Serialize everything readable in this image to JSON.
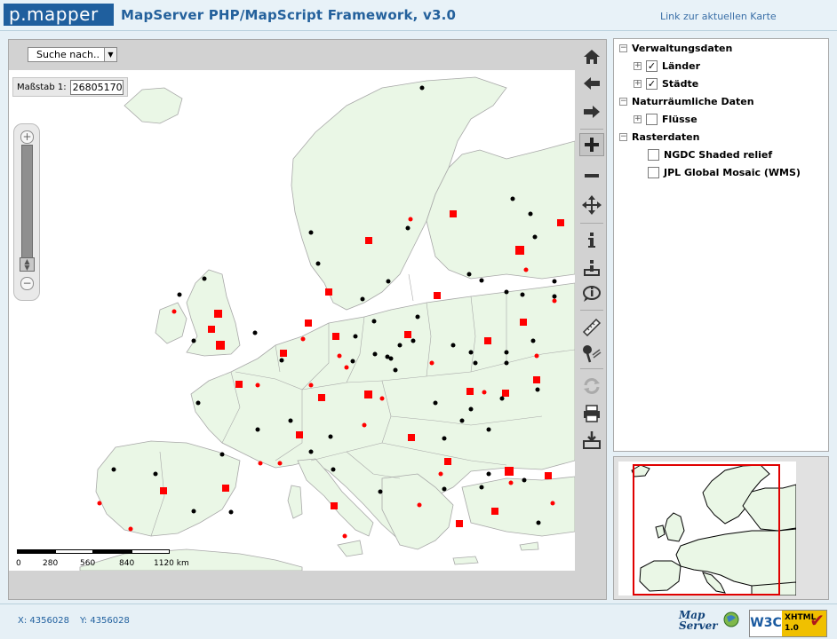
{
  "header": {
    "logo_text": "p.mapper",
    "title": "MapServer  PHP/MapScript  Framework, v3.0",
    "link_text": "Link zur aktuellen Karte"
  },
  "search": {
    "selected": "Suche nach.."
  },
  "scale": {
    "label": "Maßstab 1:",
    "value": "26805170"
  },
  "scalebar": {
    "ticks": [
      "0",
      "280",
      "560",
      "840",
      "1120 km"
    ]
  },
  "toc": {
    "groups": [
      {
        "label": "Verwaltungsdaten",
        "expanded": true,
        "layers": [
          {
            "label": "Länder",
            "checked": true,
            "expandable": true
          },
          {
            "label": "Städte",
            "checked": true,
            "expandable": true
          }
        ]
      },
      {
        "label": "Naturräumliche Daten",
        "expanded": true,
        "layers": [
          {
            "label": "Flüsse",
            "checked": false,
            "expandable": true
          }
        ]
      },
      {
        "label": "Rasterdaten",
        "expanded": true,
        "layers": [
          {
            "label": "NGDC Shaded relief",
            "checked": false,
            "expandable": false
          },
          {
            "label": "JPL Global Mosaic (WMS)",
            "checked": false,
            "expandable": false
          }
        ]
      }
    ]
  },
  "toolbar": {
    "tools": [
      "home-icon",
      "back-icon",
      "forward-icon",
      "zoom-in-icon",
      "zoom-out-icon",
      "pan-icon",
      "identify-icon",
      "select-icon",
      "info-icon",
      "measure-icon",
      "poi-icon",
      "refresh-icon",
      "print-icon",
      "download-icon"
    ],
    "active": "zoom-in-icon"
  },
  "footer": {
    "x_text": "X: 4356028",
    "y_text": "Y: 4356028",
    "mapserver_logo": "Map Server",
    "w3c_text": "W3C",
    "xhtml_text": "XHTML",
    "xhtml_version": "1.0"
  },
  "colors": {
    "land": "#eaf7e6",
    "border": "#a8a8a8",
    "city_capital": "#ff0000",
    "city": "#000000",
    "reference_extent": "#e00000",
    "header_title": "#24619c"
  }
}
